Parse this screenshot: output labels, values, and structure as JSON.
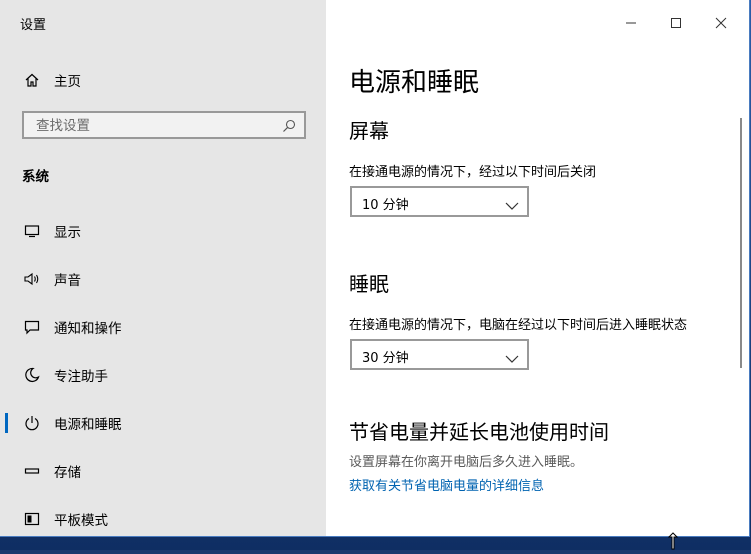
{
  "window": {
    "app_title": "设置"
  },
  "sidebar": {
    "home_label": "主页",
    "search_placeholder": "查找设置",
    "section_label": "系统",
    "items": [
      {
        "label": "显示",
        "icon": "monitor-icon"
      },
      {
        "label": "声音",
        "icon": "speaker-icon"
      },
      {
        "label": "通知和操作",
        "icon": "notification-icon"
      },
      {
        "label": "专注助手",
        "icon": "moon-icon"
      },
      {
        "label": "电源和睡眠",
        "icon": "power-icon",
        "selected": true
      },
      {
        "label": "存储",
        "icon": "drive-icon"
      },
      {
        "label": "平板模式",
        "icon": "tablet-icon"
      }
    ]
  },
  "main": {
    "title": "电源和睡眠",
    "screen": {
      "heading": "屏幕",
      "description": "在接通电源的情况下，经过以下时间后关闭",
      "value": "10 分钟"
    },
    "sleep": {
      "heading": "睡眠",
      "description": "在接通电源的情况下，电脑在经过以下时间后进入睡眠状态",
      "value": "30 分钟"
    },
    "battery": {
      "heading": "节省电量并延长电池使用时间",
      "description": "设置屏幕在你离开电脑后多久进入睡眠。",
      "link": "获取有关节省电脑电量的详细信息"
    }
  },
  "colors": {
    "accent": "#0067c0",
    "link": "#0063b1",
    "sidebar_bg": "#e6e6e6"
  }
}
